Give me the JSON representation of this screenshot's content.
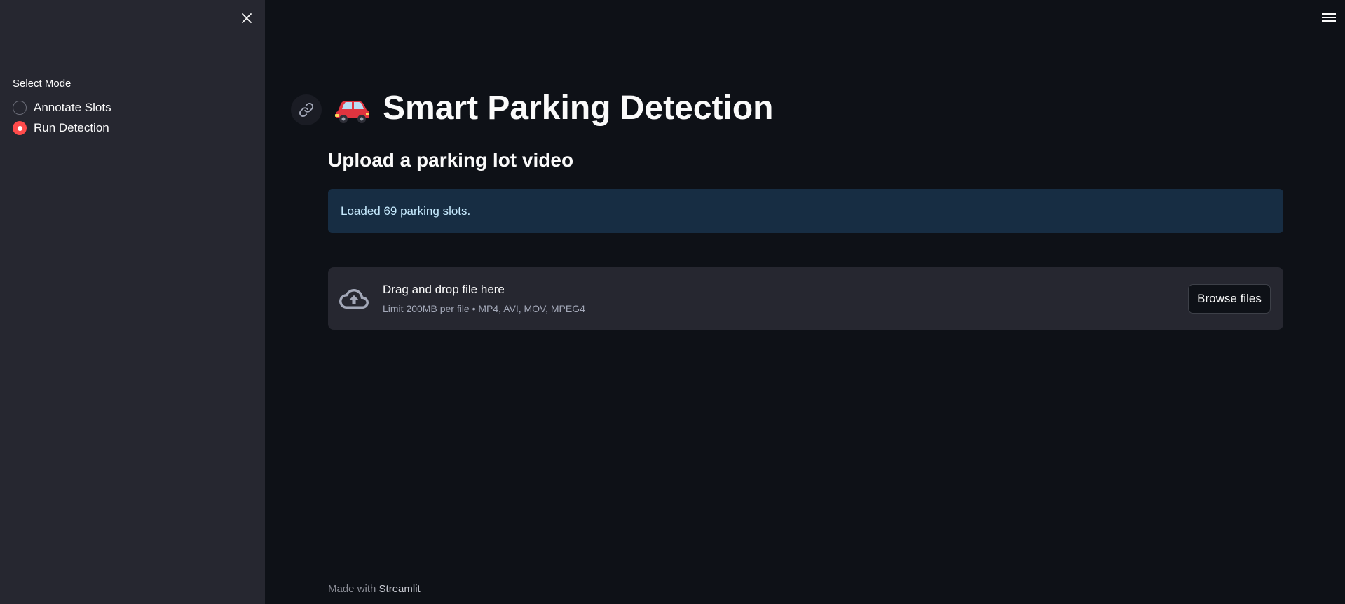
{
  "sidebar": {
    "mode_label": "Select Mode",
    "options": [
      {
        "label": "Annotate Slots",
        "selected": false
      },
      {
        "label": "Run Detection",
        "selected": true
      }
    ]
  },
  "main": {
    "title": "Smart Parking Detection",
    "title_icon": "red-car-emoji",
    "subheader": "Upload a parking lot video",
    "info_message": "Loaded 69 parking slots.",
    "uploader": {
      "title": "Drag and drop file here",
      "hint": "Limit 200MB per file • MP4, AVI, MOV, MPEG4",
      "button_label": "Browse files"
    },
    "footer": {
      "prefix": "Made with",
      "brand": "Streamlit"
    }
  },
  "colors": {
    "background": "#0e1117",
    "sidebar": "#262730",
    "accent": "#ff4b4b",
    "info_bg": "#172d43",
    "info_text": "#c7ebff"
  }
}
